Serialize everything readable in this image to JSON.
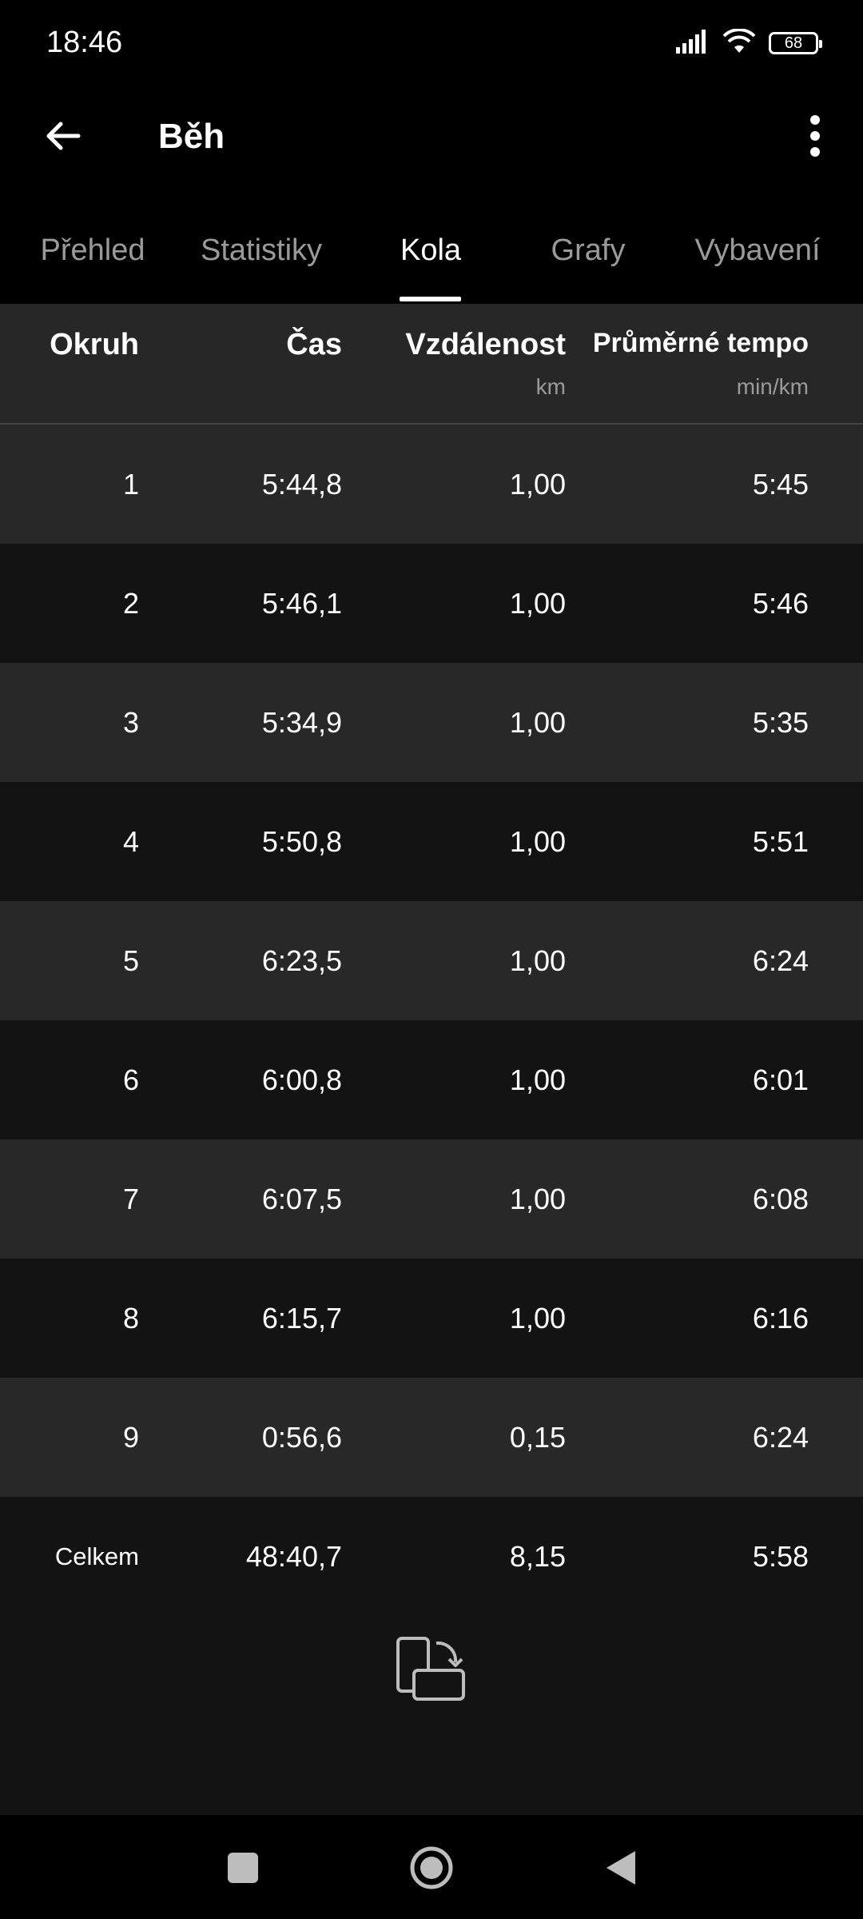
{
  "status_bar": {
    "time": "18:46",
    "battery": "68",
    "icons": [
      "signal-icon",
      "wifi-icon",
      "battery-icon"
    ]
  },
  "app_bar": {
    "title": "Běh",
    "back_icon": "arrow-left-icon",
    "menu_icon": "more-vert-icon"
  },
  "tabs": [
    {
      "label": "Přehled",
      "active": false
    },
    {
      "label": "Statistiky",
      "active": false
    },
    {
      "label": "Kola",
      "active": true
    },
    {
      "label": "Grafy",
      "active": false
    },
    {
      "label": "Vybavení",
      "active": false
    }
  ],
  "table": {
    "headers": {
      "lap": "Okruh",
      "time": "Čas",
      "distance": "Vzdálenost",
      "distance_unit": "km",
      "pace": "Průměrné tempo",
      "pace_unit": "min/km"
    },
    "rows": [
      {
        "lap": "1",
        "time": "5:44,8",
        "distance": "1,00",
        "pace": "5:45"
      },
      {
        "lap": "2",
        "time": "5:46,1",
        "distance": "1,00",
        "pace": "5:46"
      },
      {
        "lap": "3",
        "time": "5:34,9",
        "distance": "1,00",
        "pace": "5:35"
      },
      {
        "lap": "4",
        "time": "5:50,8",
        "distance": "1,00",
        "pace": "5:51"
      },
      {
        "lap": "5",
        "time": "6:23,5",
        "distance": "1,00",
        "pace": "6:24"
      },
      {
        "lap": "6",
        "time": "6:00,8",
        "distance": "1,00",
        "pace": "6:01"
      },
      {
        "lap": "7",
        "time": "6:07,5",
        "distance": "1,00",
        "pace": "6:08"
      },
      {
        "lap": "8",
        "time": "6:15,7",
        "distance": "1,00",
        "pace": "6:16"
      },
      {
        "lap": "9",
        "time": "0:56,6",
        "distance": "0,15",
        "pace": "6:24"
      }
    ],
    "total": {
      "lap": "Celkem",
      "time": "48:40,7",
      "distance": "8,15",
      "pace": "5:58"
    }
  },
  "rotate_icon": "screen-rotation-icon",
  "nav": [
    "recent-apps-icon",
    "home-icon",
    "back-icon"
  ],
  "colors": {
    "background": "#000000",
    "row_light": "#282828",
    "row_dark": "#131313",
    "muted_text": "#9a9a9a"
  }
}
